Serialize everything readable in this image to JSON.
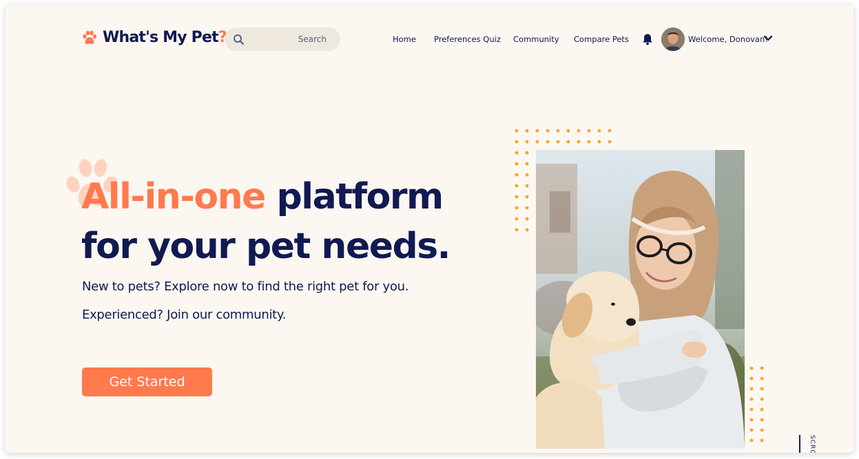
{
  "header": {
    "brand_main": "What's My Pet",
    "brand_q": "?",
    "search_placeholder": "Search",
    "nav": [
      {
        "label": "Home"
      },
      {
        "label": "Preferences Quiz"
      },
      {
        "label": "Community"
      },
      {
        "label": "Compare Pets"
      }
    ],
    "welcome": "Welcome, Donovan!"
  },
  "hero": {
    "headline_accent": "All-in-one",
    "headline_rest": " platform",
    "headline_line2": "for your pet needs.",
    "sub1": "New to pets? Explore now to find the right pet for you.",
    "sub2": "Experienced? Join our community.",
    "cta": "Get Started"
  },
  "scroll_label": "SCRO",
  "icons": [
    "paw-icon",
    "search-icon",
    "bell-icon",
    "chevron-down-icon"
  ],
  "colors": {
    "background": "#fcf7f1",
    "navy": "#101a52",
    "accent": "#ff7a4d",
    "dots": "#f5a623"
  }
}
